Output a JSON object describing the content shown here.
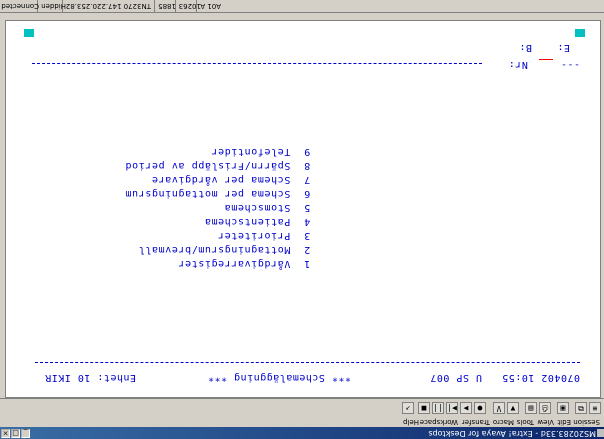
{
  "window": {
    "title": "MS20283.33d - Extra! Avaya for Desktops",
    "min_glyph": "_",
    "max_glyph": "□",
    "close_glyph": "×"
  },
  "menu": [
    "Session",
    "Edit",
    "View",
    "Tools",
    "Macro",
    "Transfer",
    "Workspace",
    "Help"
  ],
  "toolbar": {
    "buttons": [
      "≡",
      "⧉",
      "▣",
      "⎙",
      "▤",
      "▼",
      "V",
      "●",
      "▶",
      "▶|",
      "||",
      "■",
      "↗"
    ]
  },
  "terminal": {
    "header_fields": {
      "b_label": "B:",
      "e_label": "E:",
      "nr_label": "Nr:"
    },
    "menu_items": [
      {
        "number": "1",
        "label": "Vårdgivarregister"
      },
      {
        "number": "2",
        "label": "Mottagningsrum/brevmall"
      },
      {
        "number": "3",
        "label": "Prioriteter"
      },
      {
        "number": "4",
        "label": "Patientschema"
      },
      {
        "number": "5",
        "label": "Stomschema"
      },
      {
        "number": "6",
        "label": "Schema per mottagningsrum"
      },
      {
        "number": "7",
        "label": "Schema per vårdgivare"
      },
      {
        "number": "8",
        "label": "Spärrn/Frisläpp av period"
      },
      {
        "number": "9",
        "label": "Telefontider"
      }
    ],
    "footer": {
      "unit": "Enhet: 10 IKIR",
      "title": "*** Schemaläggning ***",
      "code": "U SP 007",
      "datetime": "070402 10:55"
    },
    "accent_color": "#0000cc"
  },
  "status": {
    "connected": "Connected",
    "mode": "Hidden",
    "host": "TN3270 147.220.253.82",
    "port": "1885",
    "session": "10263",
    "kbd": "A01 A"
  }
}
